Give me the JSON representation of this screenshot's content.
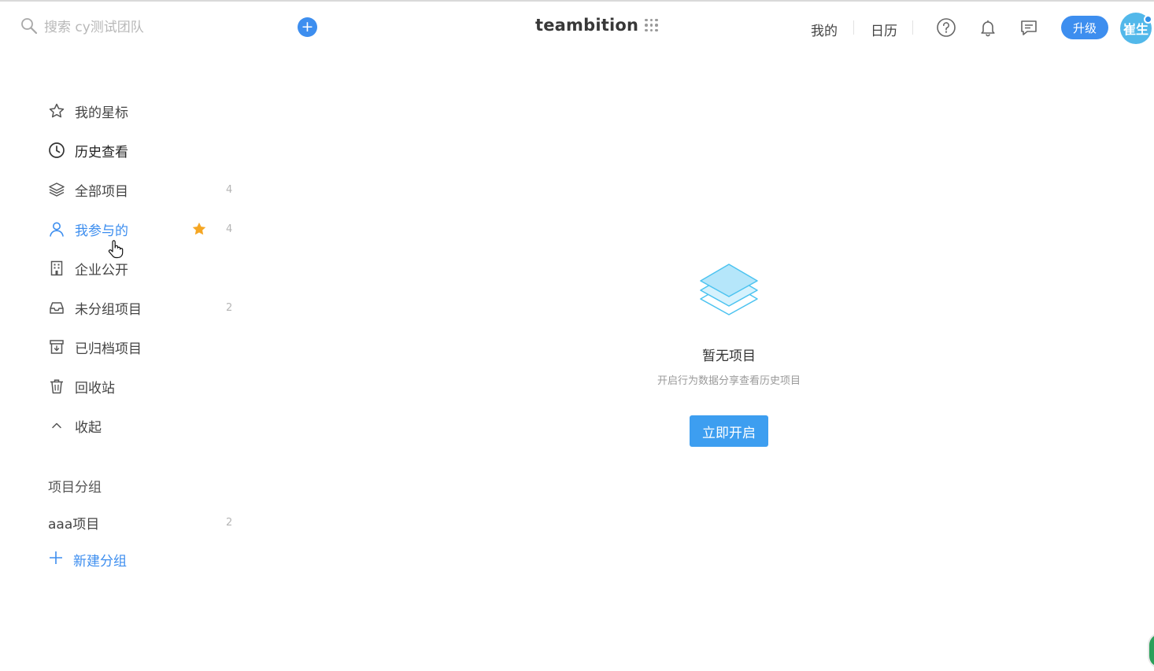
{
  "header": {
    "search_placeholder": "搜索 cy测试团队",
    "add_label": "+",
    "brand": "teambition",
    "nav": {
      "mine": "我的",
      "calendar": "日历"
    },
    "upgrade": "升级",
    "avatar_text": "崔生"
  },
  "sidebar": {
    "items": [
      {
        "label": "我的星标",
        "icon": "star-outline-icon",
        "count": ""
      },
      {
        "label": "历史查看",
        "icon": "clock-icon",
        "count": ""
      },
      {
        "label": "全部项目",
        "icon": "layers-icon",
        "count": "4"
      },
      {
        "label": "我参与的",
        "icon": "user-icon",
        "count": "4",
        "active": true,
        "starred": true
      },
      {
        "label": "企业公开",
        "icon": "building-icon",
        "count": ""
      },
      {
        "label": "未分组项目",
        "icon": "inbox-icon",
        "count": "2"
      },
      {
        "label": "已归档项目",
        "icon": "archive-icon",
        "count": ""
      },
      {
        "label": "回收站",
        "icon": "trash-icon",
        "count": ""
      },
      {
        "label": "收起",
        "icon": "chevron-up-icon",
        "count": ""
      }
    ],
    "group_title": "项目分组",
    "groups": [
      {
        "label": "aaa项目",
        "count": "2"
      }
    ],
    "new_group": "新建分组"
  },
  "empty": {
    "title": "暂无项目",
    "subtitle": "开启行为数据分享查看历史项目",
    "button": "立即开启"
  },
  "colors": {
    "accent": "#3d8eef",
    "star": "#f5a623",
    "illustration": "#4cc3f0"
  }
}
